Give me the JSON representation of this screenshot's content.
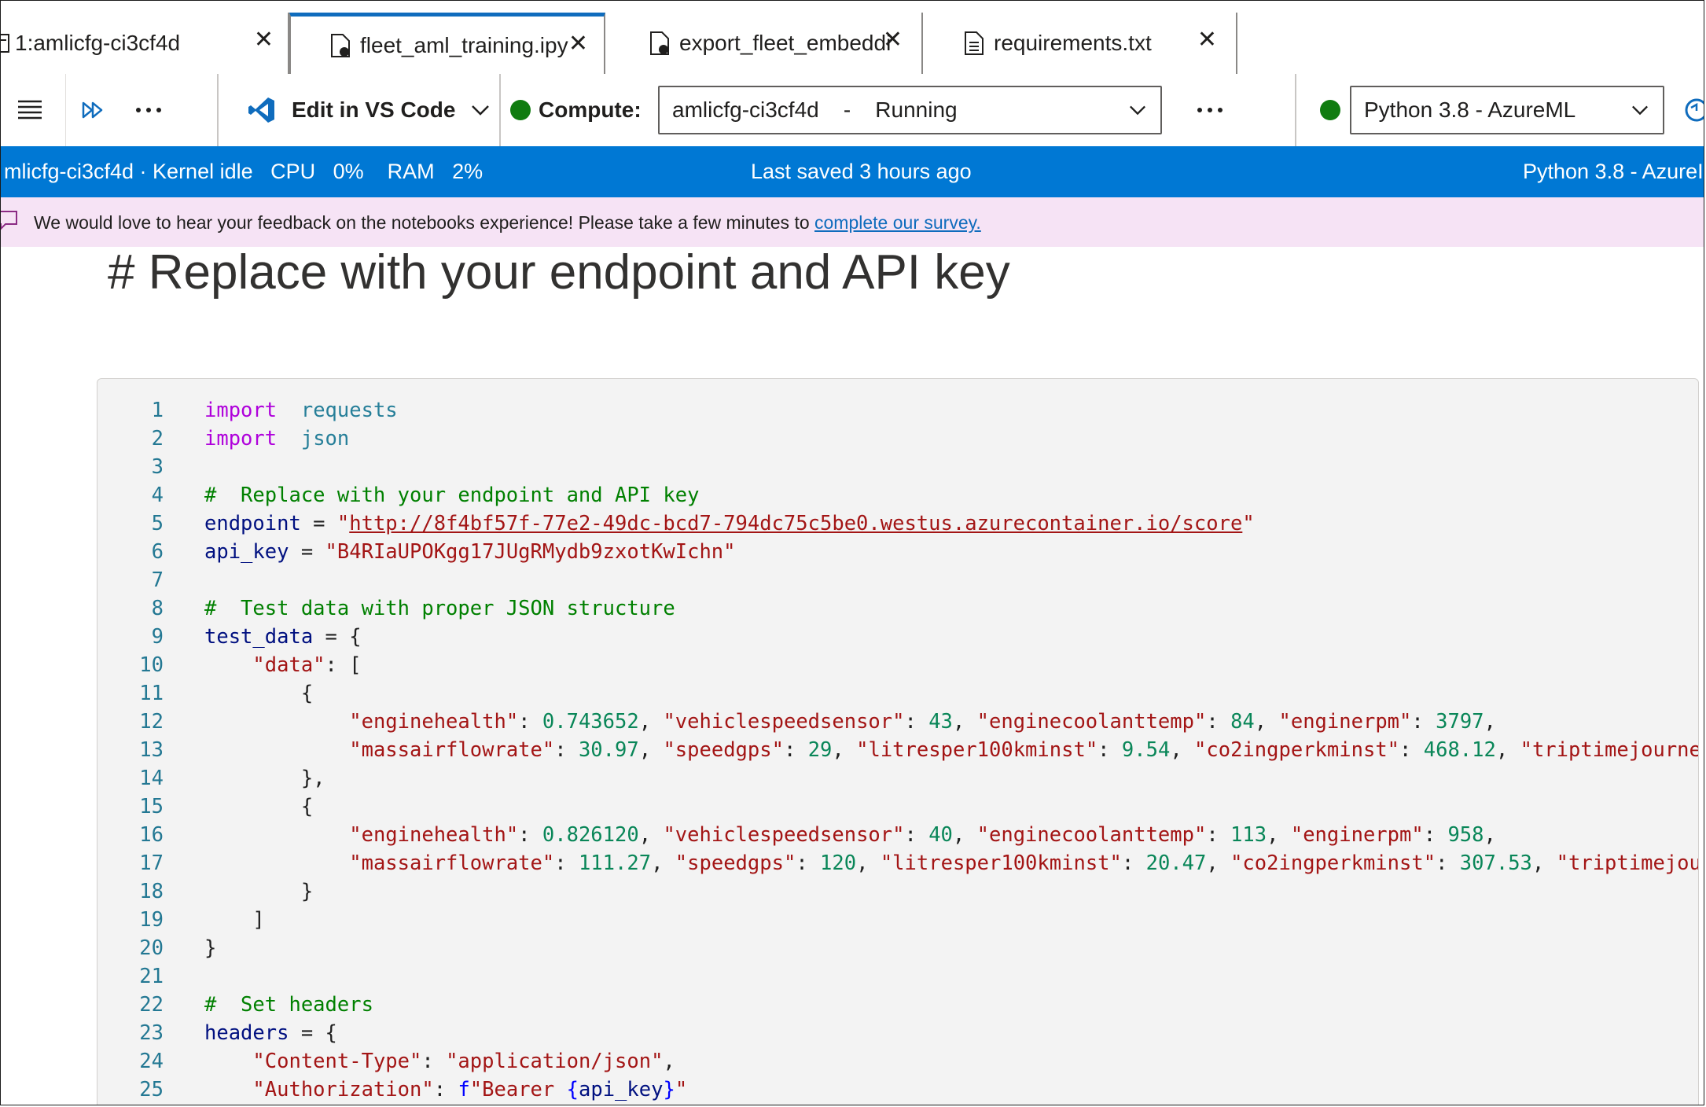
{
  "tabs": [
    {
      "label": "1:amlicfg-ci3cf4d",
      "active": false
    },
    {
      "label": "fleet_aml_training.ipy",
      "active": true
    },
    {
      "label": "export_fleet_embeddi",
      "active": false
    },
    {
      "label": "requirements.txt",
      "active": false
    }
  ],
  "toolbar": {
    "edit_vscode_label": "Edit in VS Code",
    "compute_label": "Compute:",
    "compute_value": "amlicfg-ci3cf4d    -    Running",
    "kernel_value": "Python 3.8 - AzureML"
  },
  "statusbar": {
    "left": "mlicfg-ci3cf4d · Kernel idle   CPU   0%    RAM   2%",
    "center": "Last saved 3 hours ago",
    "right": "Python 3.8 - AzureI"
  },
  "banner": {
    "text": "We would love to hear your feedback on the notebooks experience! Please take a few minutes to ",
    "link": "complete our survey."
  },
  "markdown_heading": "# Replace with your endpoint and API key",
  "code": {
    "line_numbers": [
      "1",
      "2",
      "3",
      "4",
      "5",
      "6",
      "7",
      "8",
      "9",
      "10",
      "11",
      "12",
      "13",
      "14",
      "15",
      "16",
      "17",
      "18",
      "19",
      "20",
      "21",
      "22",
      "23",
      "24",
      "25"
    ],
    "lines": [
      [
        [
          "kw",
          "import"
        ],
        [
          "",
          "  "
        ],
        [
          "mod",
          "requests"
        ]
      ],
      [
        [
          "kw",
          "import"
        ],
        [
          "",
          "  "
        ],
        [
          "mod",
          "json"
        ]
      ],
      [],
      [
        [
          "cm",
          "#  Replace with your endpoint and API key"
        ]
      ],
      [
        [
          "var",
          "endpoint"
        ],
        [
          "",
          " = "
        ],
        [
          "str",
          "\""
        ],
        [
          "str url",
          "http://8f4bf57f-77e2-49dc-bcd7-794dc75c5be0.westus.azurecontainer.io/score"
        ],
        [
          "str",
          "\""
        ]
      ],
      [
        [
          "var",
          "api_key"
        ],
        [
          "",
          " = "
        ],
        [
          "str",
          "\"B4RIaUPOKgg17JUgRMydb9zxotKwIchn\""
        ]
      ],
      [],
      [
        [
          "cm",
          "#  Test data with proper JSON structure"
        ]
      ],
      [
        [
          "var",
          "test_data"
        ],
        [
          "",
          " = {"
        ]
      ],
      [
        [
          "",
          "    "
        ],
        [
          "str",
          "\"data\""
        ],
        [
          "",
          ": ["
        ]
      ],
      [
        [
          "",
          "        {"
        ]
      ],
      [
        [
          "",
          "            "
        ],
        [
          "str",
          "\"enginehealth\""
        ],
        [
          "",
          ": "
        ],
        [
          "num",
          "0.743652"
        ],
        [
          "",
          ", "
        ],
        [
          "str",
          "\"vehiclespeedsensor\""
        ],
        [
          "",
          ": "
        ],
        [
          "num",
          "43"
        ],
        [
          "",
          ", "
        ],
        [
          "str",
          "\"enginecoolanttemp\""
        ],
        [
          "",
          ": "
        ],
        [
          "num",
          "84"
        ],
        [
          "",
          ", "
        ],
        [
          "str",
          "\"enginerpm\""
        ],
        [
          "",
          ": "
        ],
        [
          "num",
          "3797"
        ],
        [
          "",
          ","
        ]
      ],
      [
        [
          "",
          "            "
        ],
        [
          "str",
          "\"massairflowrate\""
        ],
        [
          "",
          ": "
        ],
        [
          "num",
          "30.97"
        ],
        [
          "",
          ", "
        ],
        [
          "str",
          "\"speedgps\""
        ],
        [
          "",
          ": "
        ],
        [
          "num",
          "29"
        ],
        [
          "",
          ", "
        ],
        [
          "str",
          "\"litresper100kminst\""
        ],
        [
          "",
          ": "
        ],
        [
          "num",
          "9.54"
        ],
        [
          "",
          ", "
        ],
        [
          "str",
          "\"co2ingperkminst\""
        ],
        [
          "",
          ": "
        ],
        [
          "num",
          "468.12"
        ],
        [
          "",
          ", "
        ],
        [
          "str",
          "\"triptimejourne"
        ]
      ],
      [
        [
          "",
          "        },"
        ]
      ],
      [
        [
          "",
          "        {"
        ]
      ],
      [
        [
          "",
          "            "
        ],
        [
          "str",
          "\"enginehealth\""
        ],
        [
          "",
          ": "
        ],
        [
          "num",
          "0.826120"
        ],
        [
          "",
          ", "
        ],
        [
          "str",
          "\"vehiclespeedsensor\""
        ],
        [
          "",
          ": "
        ],
        [
          "num",
          "40"
        ],
        [
          "",
          ", "
        ],
        [
          "str",
          "\"enginecoolanttemp\""
        ],
        [
          "",
          ": "
        ],
        [
          "num",
          "113"
        ],
        [
          "",
          ", "
        ],
        [
          "str",
          "\"enginerpm\""
        ],
        [
          "",
          ": "
        ],
        [
          "num",
          "958"
        ],
        [
          "",
          ","
        ]
      ],
      [
        [
          "",
          "            "
        ],
        [
          "str",
          "\"massairflowrate\""
        ],
        [
          "",
          ": "
        ],
        [
          "num",
          "111.27"
        ],
        [
          "",
          ", "
        ],
        [
          "str",
          "\"speedgps\""
        ],
        [
          "",
          ": "
        ],
        [
          "num",
          "120"
        ],
        [
          "",
          ", "
        ],
        [
          "str",
          "\"litresper100kminst\""
        ],
        [
          "",
          ": "
        ],
        [
          "num",
          "20.47"
        ],
        [
          "",
          ", "
        ],
        [
          "str",
          "\"co2ingperkminst\""
        ],
        [
          "",
          ": "
        ],
        [
          "num",
          "307.53"
        ],
        [
          "",
          ", "
        ],
        [
          "str",
          "\"triptimejou"
        ]
      ],
      [
        [
          "",
          "        }"
        ]
      ],
      [
        [
          "",
          "    ]"
        ]
      ],
      [
        [
          "",
          "}"
        ]
      ],
      [],
      [
        [
          "cm",
          "#  Set headers"
        ]
      ],
      [
        [
          "var",
          "headers"
        ],
        [
          "",
          " = {"
        ]
      ],
      [
        [
          "",
          "    "
        ],
        [
          "str",
          "\"Content-Type\""
        ],
        [
          "",
          ": "
        ],
        [
          "str",
          "\"application/json\""
        ],
        [
          "",
          ","
        ]
      ],
      [
        [
          "",
          "    "
        ],
        [
          "str",
          "\"Authorization\""
        ],
        [
          "",
          ": "
        ],
        [
          "fn",
          "f"
        ],
        [
          "str",
          "\"Bearer "
        ],
        [
          "fn",
          "{"
        ],
        [
          "var",
          "api_key"
        ],
        [
          "fn",
          "}"
        ],
        [
          "str",
          "\""
        ]
      ]
    ]
  },
  "colors": {
    "accent": "#0078d4",
    "running_dot": "#107c10",
    "banner_bg": "#f6e3f5"
  },
  "icons": [
    "notebook-icon",
    "file-icon",
    "hamburger-icon",
    "run-all-icon",
    "more-icon",
    "vscode-icon",
    "chevron-down-icon",
    "refresh-icon",
    "feedback-icon"
  ]
}
